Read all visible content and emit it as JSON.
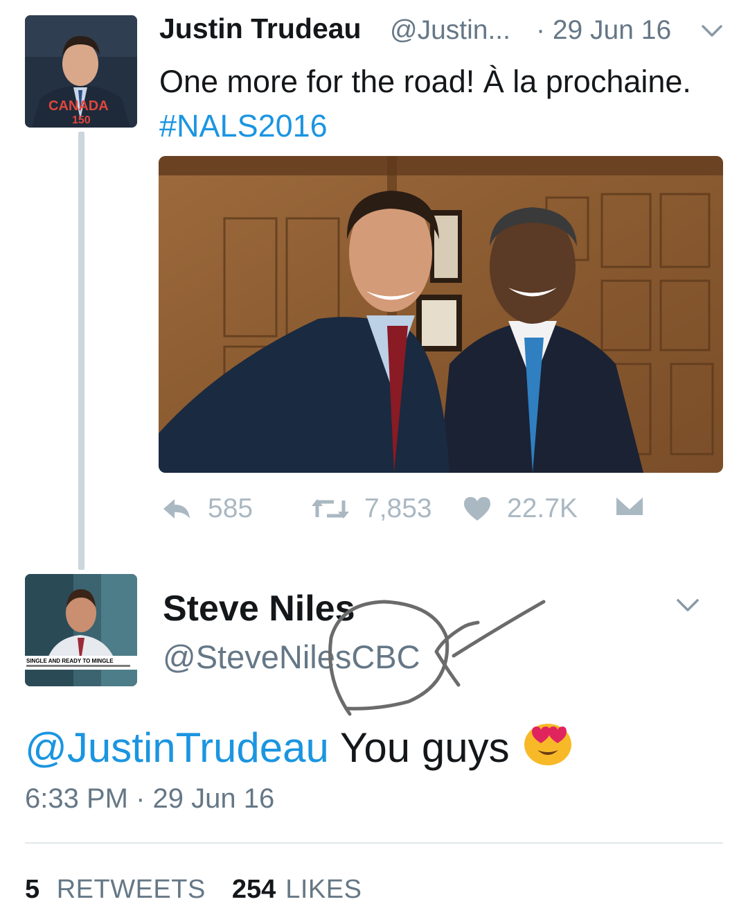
{
  "tweet1": {
    "author_name": "Justin Trudeau",
    "author_handle": "@Justin...",
    "time": "· 29 Jun 16",
    "text": "One more for the road! À la prochaine.",
    "hashtag": "#NALS2016",
    "avatar_badge": "CANADA",
    "avatar_badge_num": "150",
    "actions": {
      "reply_count": "585",
      "retweet_count": "7,853",
      "like_count": "22.7K"
    }
  },
  "tweet2": {
    "author_name": "Steve Niles",
    "author_handle": "@SteveNilesCBC",
    "avatar_banner": "SINGLE AND READY TO MINGLE",
    "mention": "@JustinTrudeau",
    "text": "You guys",
    "emoji": "smiling-face-with-heart-eyes",
    "timestamp": "6:33 PM · 29 Jun 16",
    "retweets": "5",
    "retweets_label": "RETWEETS",
    "likes": "254",
    "likes_label": "LIKES"
  },
  "colors": {
    "link_blue": "#1b95e0",
    "secondary_gray": "#657786",
    "action_gray": "#aab8c2",
    "thread_line": "#ccd6dd",
    "annotation_stroke": "#6b6b6b"
  }
}
